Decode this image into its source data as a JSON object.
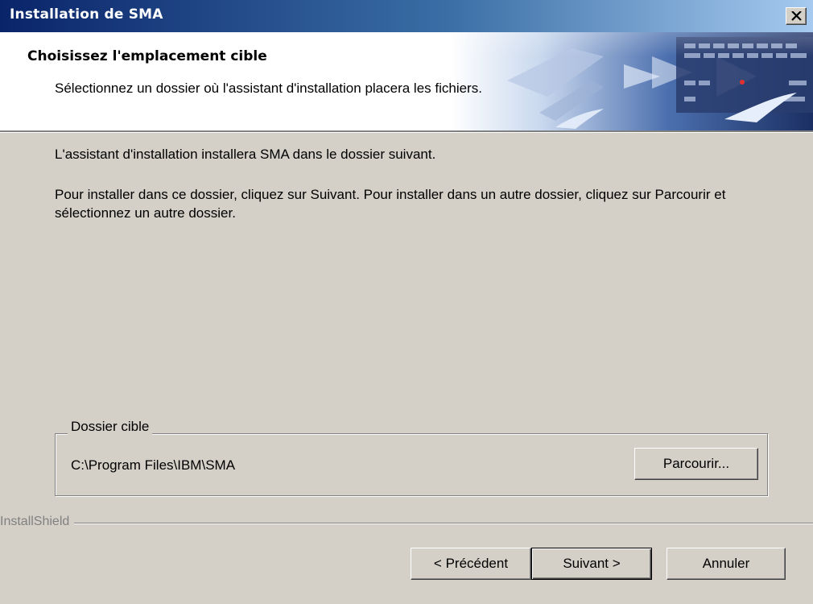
{
  "window": {
    "title": "Installation de SMA",
    "title_bar_color": "#0a246a"
  },
  "header": {
    "heading": "Choisissez l'emplacement cible",
    "subheading": "Sélectionnez un dossier où l'assistant d'installation placera les fichiers."
  },
  "body": {
    "intro": "L'assistant d'installation installera SMA dans le dossier suivant.",
    "instructions": "Pour installer dans ce dossier, cliquez sur Suivant. Pour installer dans un autre dossier, cliquez sur Parcourir et sélectionnez un autre dossier."
  },
  "destination": {
    "group_label": "Dossier cible",
    "path": "C:\\Program Files\\IBM\\SMA",
    "browse_label": "Parcourir..."
  },
  "footer": {
    "brand": "InstallShield",
    "back_label": "< Précédent",
    "next_label": "Suivant >",
    "cancel_label": "Annuler"
  },
  "icons": {
    "close": "close-icon",
    "header_art": "setup-banner-graphic"
  }
}
